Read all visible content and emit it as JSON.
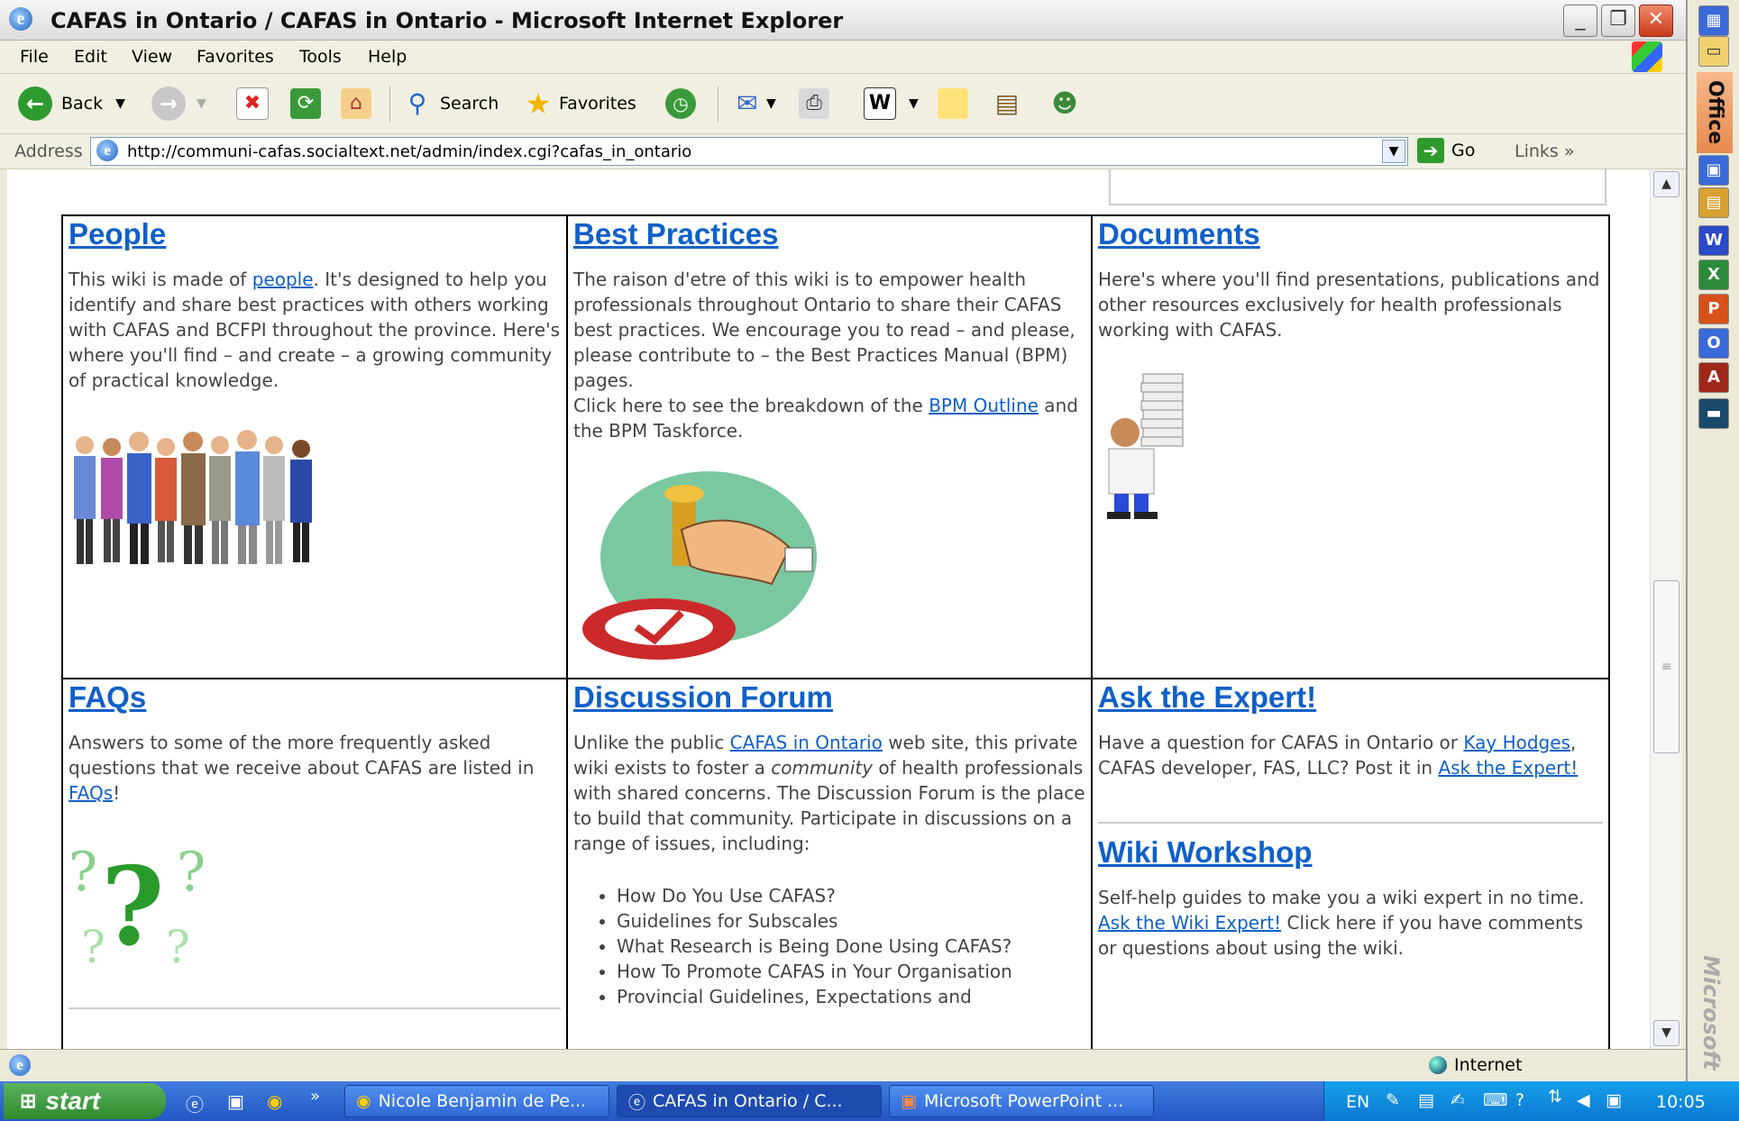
{
  "window": {
    "title": "CAFAS in Ontario / CAFAS in Ontario - Microsoft Internet Explorer"
  },
  "menu": [
    "File",
    "Edit",
    "View",
    "Favorites",
    "Tools",
    "Help"
  ],
  "toolbar": {
    "back": "Back",
    "search": "Search",
    "favorites": "Favorites"
  },
  "address": {
    "label": "Address",
    "url": "http://communi-cafas.socialtext.net/admin/index.cgi?cafas_in_ontario",
    "go": "Go",
    "links": "Links"
  },
  "cells": {
    "people": {
      "title": "People",
      "text1": "This wiki is made of ",
      "link": "people",
      "text2": ". It's designed to help you identify and share best practices with others working with CAFAS and BCFPI throughout the province. Here's where you'll find – and create – a growing community of practical knowledge."
    },
    "best_practices": {
      "title": "Best Practices",
      "text1": "The raison d'etre of this wiki is to empower health professionals throughout Ontario to share their CAFAS best practices. We encourage you to read – and please, please contribute to – the Best Practices Manual (BPM) pages.",
      "text2": "Click here to see the breakdown of the ",
      "link": "BPM Outline",
      "text3": " and the BPM Taskforce."
    },
    "documents": {
      "title": "Documents",
      "text": "Here's where you'll find presentations, publications and other resources exclusively for health professionals working with CAFAS."
    },
    "faqs": {
      "title": "FAQs",
      "text1": "Answers to some of the more frequently asked questions that we receive about CAFAS are listed in ",
      "link": "FAQs",
      "text2": "!"
    },
    "discussion": {
      "title": "Discussion Forum",
      "text1": "Unlike the public ",
      "link": "CAFAS in Ontario",
      "text2": " web site, this private wiki exists to foster a ",
      "em": "community",
      "text3": " of health professionals with shared concerns. The Discussion Forum is the place to build that community. Participate in discussions on a range of issues, including:",
      "items": [
        "How Do You Use CAFAS?",
        "Guidelines for Subscales",
        "What Research is Being Done Using CAFAS?",
        "How To Promote CAFAS in Your Organisation",
        "Provincial Guidelines, Expectations and"
      ]
    },
    "expert": {
      "title": "Ask the Expert!",
      "text1": "Have a question for CAFAS in Ontario or ",
      "link1": "Kay Hodges",
      "text2": ", CAFAS developer, FAS, LLC? Post it in ",
      "link2": "Ask the Expert!"
    },
    "workshop": {
      "title": "Wiki Workshop",
      "text1": "Self-help guides to make you a wiki expert in no time.",
      "link": "Ask the Wiki Expert!",
      "text2": " Click here if you have comments or questions about using the wiki."
    }
  },
  "statusbar": {
    "zone": "Internet"
  },
  "taskbar": {
    "start": "start",
    "tasks": [
      "Nicole Benjamin de Pe...",
      "CAFAS in Ontario / C...",
      "Microsoft PowerPoint ..."
    ],
    "lang": "EN",
    "clock": "10:05"
  },
  "officebar": {
    "label": "Office",
    "brand": "Microsoft"
  }
}
